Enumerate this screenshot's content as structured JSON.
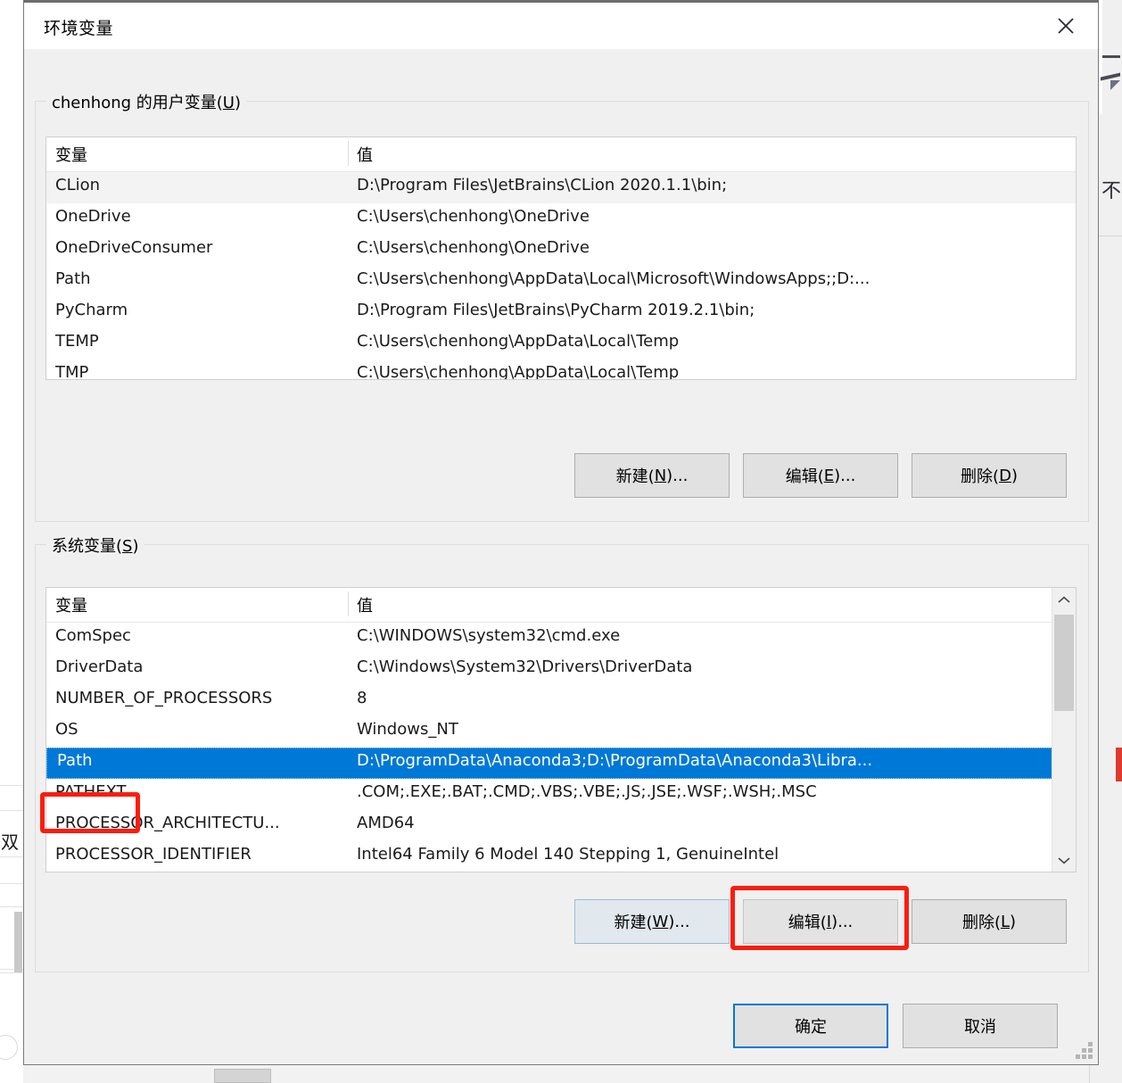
{
  "window": {
    "title": "环境变量",
    "close_icon": "close-icon"
  },
  "user_section": {
    "legend_prefix": "chenhong 的用户变量(",
    "legend_accel": "U",
    "legend_suffix": ")",
    "columns": {
      "name": "变量",
      "value": "值"
    },
    "rows": [
      {
        "name": "CLion",
        "value": "D:\\Program Files\\JetBrains\\CLion 2020.1.1\\bin;"
      },
      {
        "name": "OneDrive",
        "value": "C:\\Users\\chenhong\\OneDrive"
      },
      {
        "name": "OneDriveConsumer",
        "value": "C:\\Users\\chenhong\\OneDrive"
      },
      {
        "name": "Path",
        "value": "C:\\Users\\chenhong\\AppData\\Local\\Microsoft\\WindowsApps;;D:..."
      },
      {
        "name": "PyCharm",
        "value": "D:\\Program Files\\JetBrains\\PyCharm 2019.2.1\\bin;"
      },
      {
        "name": "TEMP",
        "value": "C:\\Users\\chenhong\\AppData\\Local\\Temp"
      },
      {
        "name": "TMP",
        "value": "C:\\Users\\chenhong\\AppData\\Local\\Temp"
      }
    ],
    "buttons": {
      "new": {
        "prefix": "新建(",
        "accel": "N",
        "suffix": ")..."
      },
      "edit": {
        "prefix": "编辑(",
        "accel": "E",
        "suffix": ")..."
      },
      "delete": {
        "prefix": "删除(",
        "accel": "D",
        "suffix": ")"
      }
    }
  },
  "system_section": {
    "legend_prefix": "系统变量(",
    "legend_accel": "S",
    "legend_suffix": ")",
    "columns": {
      "name": "变量",
      "value": "值"
    },
    "rows": [
      {
        "name": "ComSpec",
        "value": "C:\\WINDOWS\\system32\\cmd.exe"
      },
      {
        "name": "DriverData",
        "value": "C:\\Windows\\System32\\Drivers\\DriverData"
      },
      {
        "name": "NUMBER_OF_PROCESSORS",
        "value": "8"
      },
      {
        "name": "OS",
        "value": "Windows_NT"
      },
      {
        "name": "Path",
        "value": "D:\\ProgramData\\Anaconda3;D:\\ProgramData\\Anaconda3\\Libra..."
      },
      {
        "name": "PATHEXT",
        "value": ".COM;.EXE;.BAT;.CMD;.VBS;.VBE;.JS;.JSE;.WSF;.WSH;.MSC"
      },
      {
        "name": "PROCESSOR_ARCHITECTU...",
        "value": "AMD64"
      },
      {
        "name": "PROCESSOR_IDENTIFIER",
        "value": "Intel64 Family 6 Model 140 Stepping 1, GenuineIntel"
      }
    ],
    "selected_row_index": 4,
    "scrollbar": {
      "up_icon": "chevron-up-icon",
      "down_icon": "chevron-down-icon"
    },
    "buttons": {
      "new": {
        "prefix": "新建(",
        "accel": "W",
        "suffix": ")..."
      },
      "edit": {
        "prefix": "编辑(",
        "accel": "I",
        "suffix": ")..."
      },
      "delete": {
        "prefix": "删除(",
        "accel": "L",
        "suffix": ")"
      }
    }
  },
  "footer": {
    "ok": "确定",
    "cancel": "取消"
  },
  "annotations": {
    "highlight_color": "#fb1d0e",
    "boxes": [
      {
        "target": "system-path-row-name"
      },
      {
        "target": "system-edit-button"
      }
    ]
  },
  "colors": {
    "selection": "#0078d7",
    "dialog_bg": "#f0f0f0",
    "list_bg": "#ffffff",
    "button_bg": "#e1e1e1"
  }
}
